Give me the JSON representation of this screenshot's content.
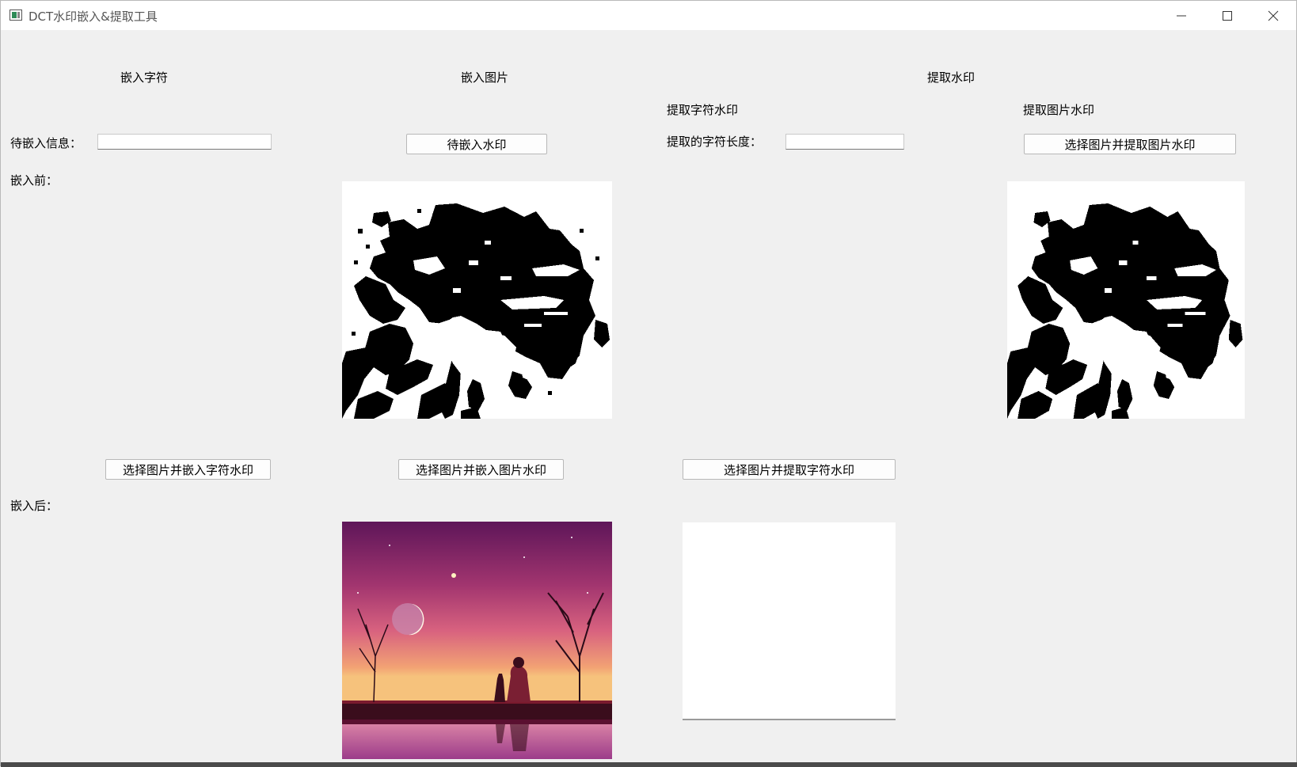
{
  "window": {
    "title": "DCT水印嵌入&提取工具",
    "minimize_icon": "minimize-icon",
    "maximize_icon": "maximize-icon",
    "close_icon": "close-icon"
  },
  "sections": {
    "embed_text": "嵌入字符",
    "embed_image": "嵌入图片",
    "extract": "提取水印",
    "extract_text": "提取字符水印",
    "extract_image": "提取图片水印"
  },
  "labels": {
    "info_to_embed": "待嵌入信息：",
    "before": "嵌入前：",
    "after": "嵌入后：",
    "extracted_length": "提取的字符长度："
  },
  "inputs": {
    "info_value": "",
    "length_value": ""
  },
  "buttons": {
    "watermark_to_embed": "待嵌入水印",
    "select_embed_text": "选择图片并嵌入字符水印",
    "select_embed_image": "选择图片并嵌入图片水印",
    "select_extract_text": "选择图片并提取字符水印",
    "select_extract_image": "选择图片并提取图片水印"
  },
  "images": {
    "watermark_preview": "flower-watermark-image",
    "extracted_watermark": "flower-extracted-image",
    "embedded_result": "sunset-landscape-image"
  },
  "colors": {
    "window_bg": "#f0f0f0",
    "titlebar_bg": "#ffffff",
    "sky_top": "#6a1b5e",
    "sky_mid": "#c0457e",
    "sky_horizon": "#f4b27a"
  }
}
